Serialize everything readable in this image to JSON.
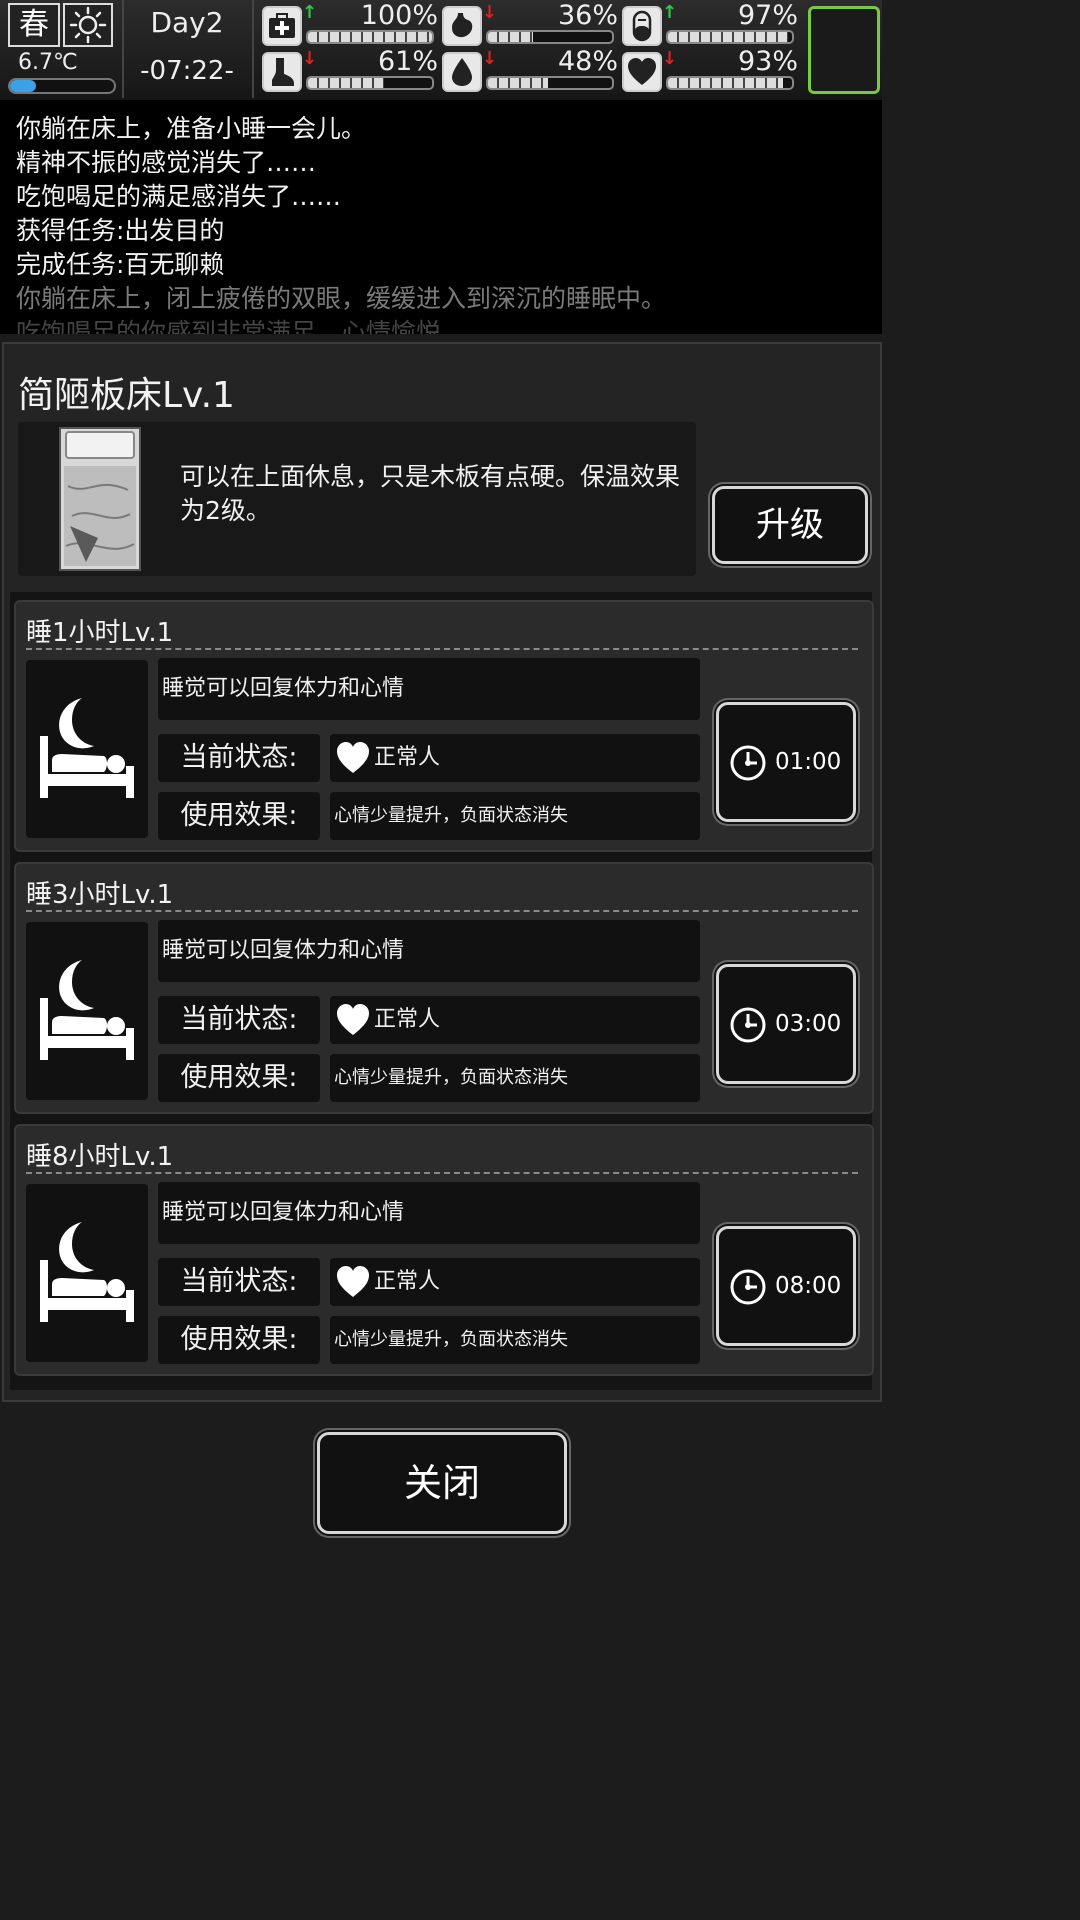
{
  "status_bar": {
    "season": "春",
    "weather_icon": "sun-icon",
    "temperature": "6.7℃",
    "temperature_level": 0.25,
    "day": "Day2",
    "time": "-07:22-",
    "stats": [
      {
        "icon": "medkit-icon",
        "arrow": "up",
        "arrow_color": "#2ecc40",
        "percent": "100%",
        "level": 1.0
      },
      {
        "icon": "stomach-icon",
        "arrow": "down",
        "arrow_color": "#e02020",
        "percent": "36%",
        "level": 0.36
      },
      {
        "icon": "capsule-icon",
        "arrow": "up",
        "arrow_color": "#2ecc40",
        "percent": "97%",
        "level": 0.97
      },
      {
        "icon": "foot-icon",
        "arrow": "down",
        "arrow_color": "#e02020",
        "percent": "61%",
        "level": 0.61
      },
      {
        "icon": "water-drop-icon",
        "arrow": "down",
        "arrow_color": "#e02020",
        "percent": "48%",
        "level": 0.48
      },
      {
        "icon": "heart-icon",
        "arrow": "down",
        "arrow_color": "#e02020",
        "percent": "93%",
        "level": 0.93
      }
    ],
    "avatar_border_color": "#7ac943"
  },
  "log": [
    {
      "text": "你躺在床上，准备小睡一会儿。",
      "style": "normal"
    },
    {
      "text": "精神不振的感觉消失了……",
      "style": "normal"
    },
    {
      "text": "吃饱喝足的满足感消失了……",
      "style": "normal"
    },
    {
      "text": "获得任务:出发目的",
      "style": "normal"
    },
    {
      "text": "完成任务:百无聊赖",
      "style": "normal"
    },
    {
      "text": "你躺在床上，闭上疲倦的双眼，缓缓进入到深沉的睡眠中。",
      "style": "dim"
    },
    {
      "text": "吃饱喝足的你感到非常满足，心情愉悦。",
      "style": "dim2"
    }
  ],
  "bed": {
    "title": "简陋板床Lv.1",
    "description": "可以在上面休息，只是木板有点硬。保温效果为2级。",
    "upgrade_label": "升级"
  },
  "sleep_options": [
    {
      "title": "睡1小时Lv.1",
      "description": "睡觉可以回复体力和心情",
      "status_label": "当前状态:",
      "status_value": "正常人",
      "effect_label": "使用效果:",
      "effect_value": "心情少量提升，负面状态消失",
      "time": "01:00"
    },
    {
      "title": "睡3小时Lv.1",
      "description": "睡觉可以回复体力和心情",
      "status_label": "当前状态:",
      "status_value": "正常人",
      "effect_label": "使用效果:",
      "effect_value": "心情少量提升，负面状态消失",
      "time": "03:00"
    },
    {
      "title": "睡8小时Lv.1",
      "description": "睡觉可以回复体力和心情",
      "status_label": "当前状态:",
      "status_value": "正常人",
      "effect_label": "使用效果:",
      "effect_value": "心情少量提升，负面状态消失",
      "time": "08:00"
    }
  ],
  "close_label": "关闭"
}
